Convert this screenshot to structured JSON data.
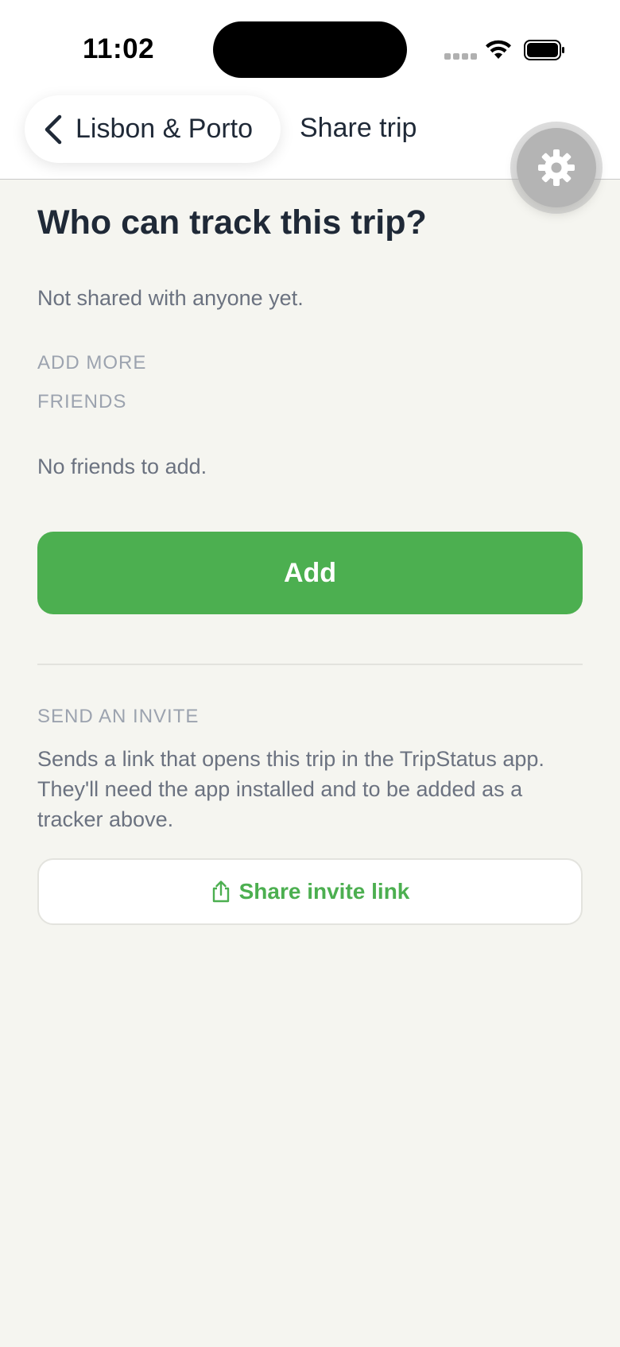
{
  "status_bar": {
    "time": "11:02"
  },
  "nav": {
    "back_label": "Lisbon & Porto",
    "title": "Share trip"
  },
  "content": {
    "heading": "Who can track this trip?",
    "not_shared": "Not shared with anyone yet.",
    "add_more_label": "ADD MORE",
    "friends_label": "FRIENDS",
    "no_friends": "No friends to add.",
    "add_button": "Add",
    "invite_label": "SEND AN INVITE",
    "invite_description": "Sends a link that opens this trip in the TripStatus app. They'll need the app installed and to be added as a tracker above.",
    "share_button": "Share invite link"
  },
  "icons": {
    "back": "chevron-left-icon",
    "settings": "gear-icon",
    "share": "share-icon",
    "wifi": "wifi-icon",
    "battery": "battery-icon",
    "signal": "signal-icon"
  },
  "colors": {
    "accent": "#4caf50",
    "background": "#f5f5f0",
    "text_primary": "#1f2937",
    "text_secondary": "#6b7280",
    "text_muted": "#9ca3af"
  }
}
